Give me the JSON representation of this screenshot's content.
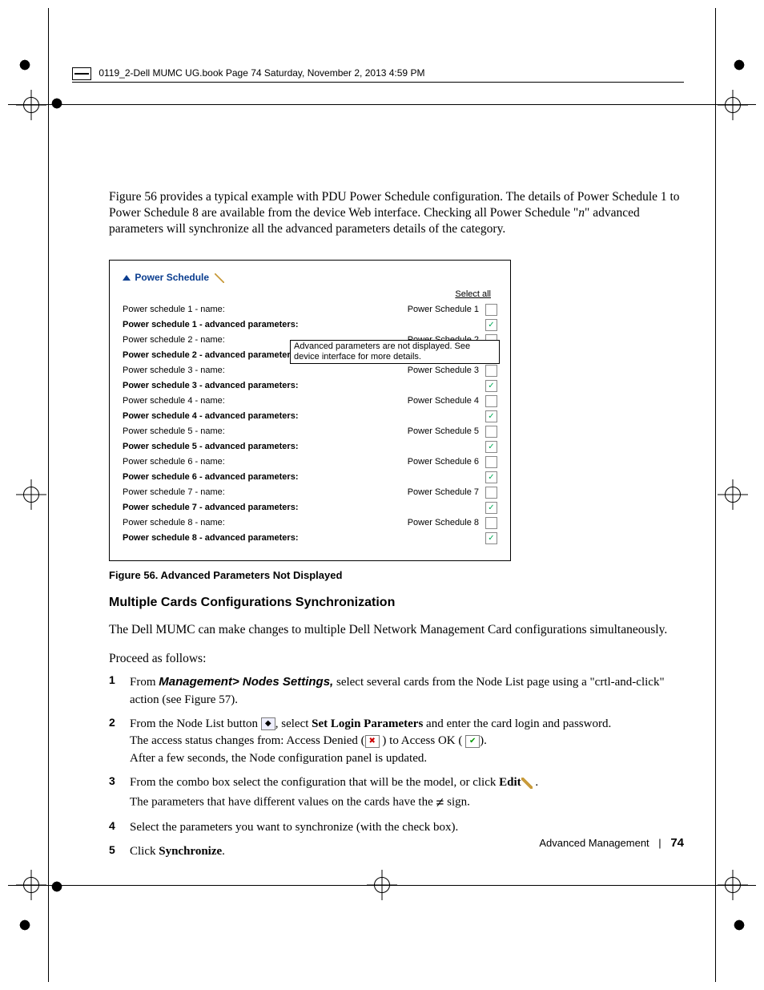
{
  "header_text": "0119_2-Dell MUMC UG.book  Page 74  Saturday, November 2, 2013  4:59 PM",
  "intro": {
    "p1_a": "Figure 56 provides a typical example with PDU Power Schedule configuration. The details of Power Schedule 1 to Power Schedule 8 are available from the device Web interface. Checking all Power Schedule \"",
    "p1_i": "n",
    "p1_b": "\" advanced parameters will synchronize all the advanced parameters details of the category."
  },
  "figure": {
    "title": "Power Schedule",
    "select_all": "Select all",
    "tooltip": "Advanced parameters are not displayed. See device interface for more details.",
    "rows": [
      {
        "label": "Power schedule 1 - name:",
        "value": "Power Schedule 1",
        "checked": false,
        "bold": false
      },
      {
        "label": "Power schedule 1 - advanced parameters:",
        "value": "",
        "checked": true,
        "bold": true
      },
      {
        "label": "Power schedule 2 - name:",
        "value": "Power Schedule 2",
        "checked": false,
        "bold": false
      },
      {
        "label": "Power schedule 2 - advanced parameters:",
        "value": "",
        "checked": true,
        "bold": true
      },
      {
        "label": "Power schedule 3 - name:",
        "value": "Power Schedule 3",
        "checked": false,
        "bold": false
      },
      {
        "label": "Power schedule 3 - advanced parameters:",
        "value": "",
        "checked": true,
        "bold": true
      },
      {
        "label": "Power schedule 4 - name:",
        "value": "Power Schedule 4",
        "checked": false,
        "bold": false
      },
      {
        "label": "Power schedule 4 - advanced parameters:",
        "value": "",
        "checked": true,
        "bold": true
      },
      {
        "label": "Power schedule 5 - name:",
        "value": "Power Schedule 5",
        "checked": false,
        "bold": false
      },
      {
        "label": "Power schedule 5 - advanced parameters:",
        "value": "",
        "checked": true,
        "bold": true
      },
      {
        "label": "Power schedule 6 - name:",
        "value": "Power Schedule 6",
        "checked": false,
        "bold": false
      },
      {
        "label": "Power schedule 6 - advanced parameters:",
        "value": "",
        "checked": true,
        "bold": true
      },
      {
        "label": "Power schedule 7 - name:",
        "value": "Power Schedule 7",
        "checked": false,
        "bold": false
      },
      {
        "label": "Power schedule 7 - advanced parameters:",
        "value": "",
        "checked": true,
        "bold": true
      },
      {
        "label": "Power schedule 8 - name:",
        "value": "Power Schedule 8",
        "checked": false,
        "bold": false
      },
      {
        "label": "Power schedule 8 - advanced parameters:",
        "value": "",
        "checked": true,
        "bold": true
      }
    ],
    "caption": "Figure 56.  Advanced Parameters Not Displayed"
  },
  "section": {
    "heading": "Multiple Cards Configurations Synchronization",
    "p1": "The Dell MUMC can make changes to multiple Dell Network Management Card configurations simultaneously.",
    "p2": "Proceed as follows:",
    "steps": {
      "s1_a": "From ",
      "s1_b": "Management> Nodes Settings,",
      "s1_c": " select several cards from the Node List page using a \"crtl-and-click\" action (see Figure 57).",
      "s2_a": "From the Node List button ",
      "s2_b": ", select ",
      "s2_c": "Set Login Parameters",
      "s2_d": " and enter the card login and password.",
      "s2_e": "The access status changes from: Access Denied (",
      "s2_f": " ) to Access OK ( ",
      "s2_g": ").",
      "s2_h": "After a few seconds, the Node configuration panel is updated.",
      "s3_a": "From the combo box select the configuration that will be the model, or click ",
      "s3_b": "Edit",
      "s3_c": " .",
      "s3_d": "The parameters that have different values on the cards have the ",
      "s3_e": " sign.",
      "s4": "Select the parameters you want to synchronize (with the check box).",
      "s5_a": "Click ",
      "s5_b": "Synchronize",
      "s5_c": "."
    }
  },
  "footer": {
    "section": "Advanced Management",
    "page": "74"
  }
}
